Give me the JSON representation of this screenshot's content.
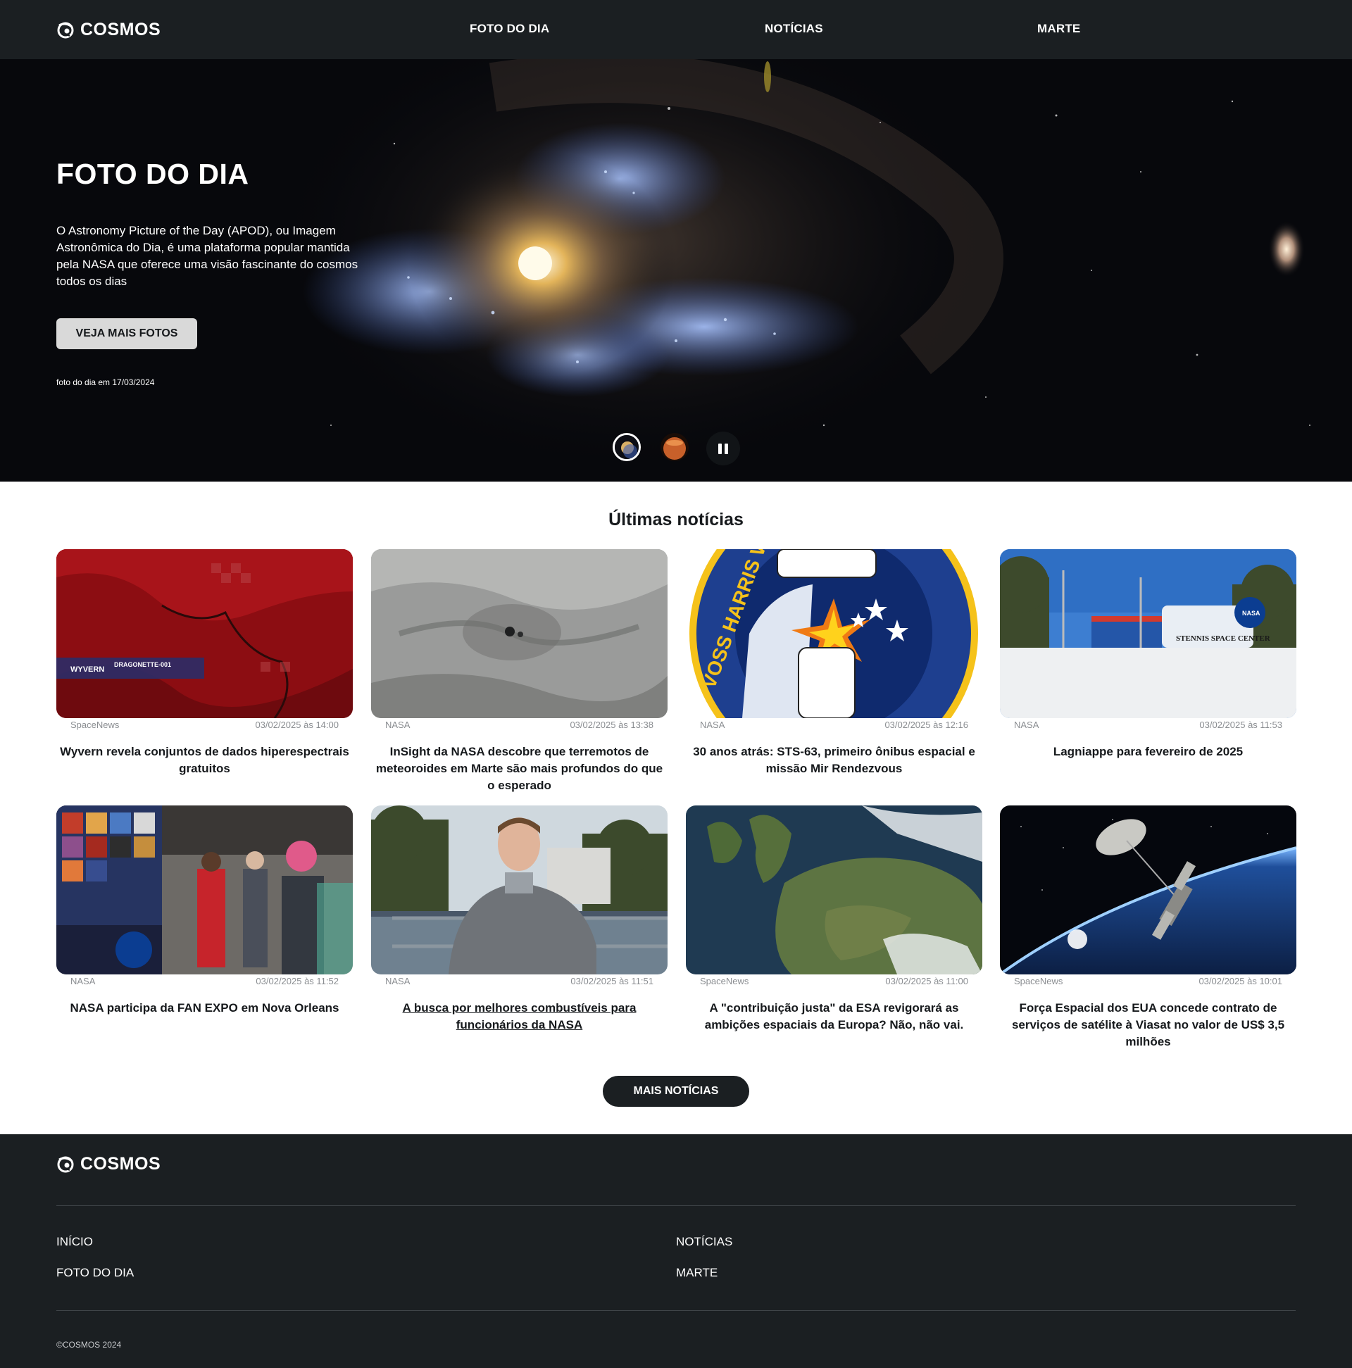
{
  "header": {
    "brand": "COSMOS",
    "nav": [
      {
        "label": "FOTO DO DIA"
      },
      {
        "label": "NOTÍCIAS"
      },
      {
        "label": "MARTE"
      }
    ]
  },
  "hero": {
    "title": "FOTO DO DIA",
    "description": "O Astronomy Picture of the Day (APOD), ou Imagem Astronômica do Dia, é uma plataforma popular mantida pela NASA que oferece uma visão fascinante do cosmos todos os dias",
    "button_label": "VEJA MAIS FOTOS",
    "caption": "foto do dia em 17/03/2024",
    "slides_count": 2,
    "active_slide": 1
  },
  "news": {
    "title": "Últimas notícias",
    "items": [
      {
        "source": "SpaceNews",
        "date": "03/02/2025 às 14:00",
        "title": "Wyvern revela conjuntos de dados hiperespectrais gratuitos",
        "image": "hyperspectral-map"
      },
      {
        "source": "NASA",
        "date": "03/02/2025 às 13:38",
        "title": "InSight da NASA descobre que terremotos de meteoroides em Marte são mais profundos do que o esperado",
        "image": "mars-crater"
      },
      {
        "source": "NASA",
        "date": "03/02/2025 às 12:16",
        "title": "30 anos atrás: STS-63, primeiro ônibus espacial e missão Mir Rendezvous",
        "image": "mission-patch"
      },
      {
        "source": "NASA",
        "date": "03/02/2025 às 11:53",
        "title": "Lagniappe para fevereiro de 2025",
        "image": "stennis-space-center"
      },
      {
        "source": "NASA",
        "date": "03/02/2025 às 11:52",
        "title": "NASA participa da FAN EXPO em Nova Orleans",
        "image": "fan-expo-booth"
      },
      {
        "source": "NASA",
        "date": "03/02/2025 às 11:51",
        "title": "A busca por melhores combustíveis para funcionários da NASA",
        "image": "employee-portrait"
      },
      {
        "source": "SpaceNews",
        "date": "03/02/2025 às 11:00",
        "title": "A \"contribuição justa\" da ESA revigorará as ambições espaciais da Europa? Não, não vai.",
        "image": "europe-satellite"
      },
      {
        "source": "SpaceNews",
        "date": "03/02/2025 às 10:01",
        "title": "Força Espacial dos EUA concede contrato de serviços de satélite à Viasat no valor de US$ 3,5 milhões",
        "image": "satellite-orbit"
      }
    ],
    "more_label": "MAIS NOTÍCIAS",
    "image_texts": {
      "wyvern_brand": "WYVERN",
      "wyvern_sat": "DRAGONETTE-001",
      "patch_text": "VOSS HARRIS W     S FOALE TITOV",
      "stennis_sign": "STENNIS SPACE CENTER",
      "nasa": "NASA"
    }
  },
  "footer": {
    "brand": "COSMOS",
    "links": [
      {
        "label": "INÍCIO"
      },
      {
        "label": "NOTÍCIAS"
      },
      {
        "label": "FOTO DO DIA"
      },
      {
        "label": "MARTE"
      }
    ],
    "copyright": "©COSMOS 2024"
  },
  "colors": {
    "header_bg": "#1b1f22",
    "text_dark": "#16191c",
    "meta_gray": "#8a8d91",
    "hero_button": "#d9d9d9"
  }
}
